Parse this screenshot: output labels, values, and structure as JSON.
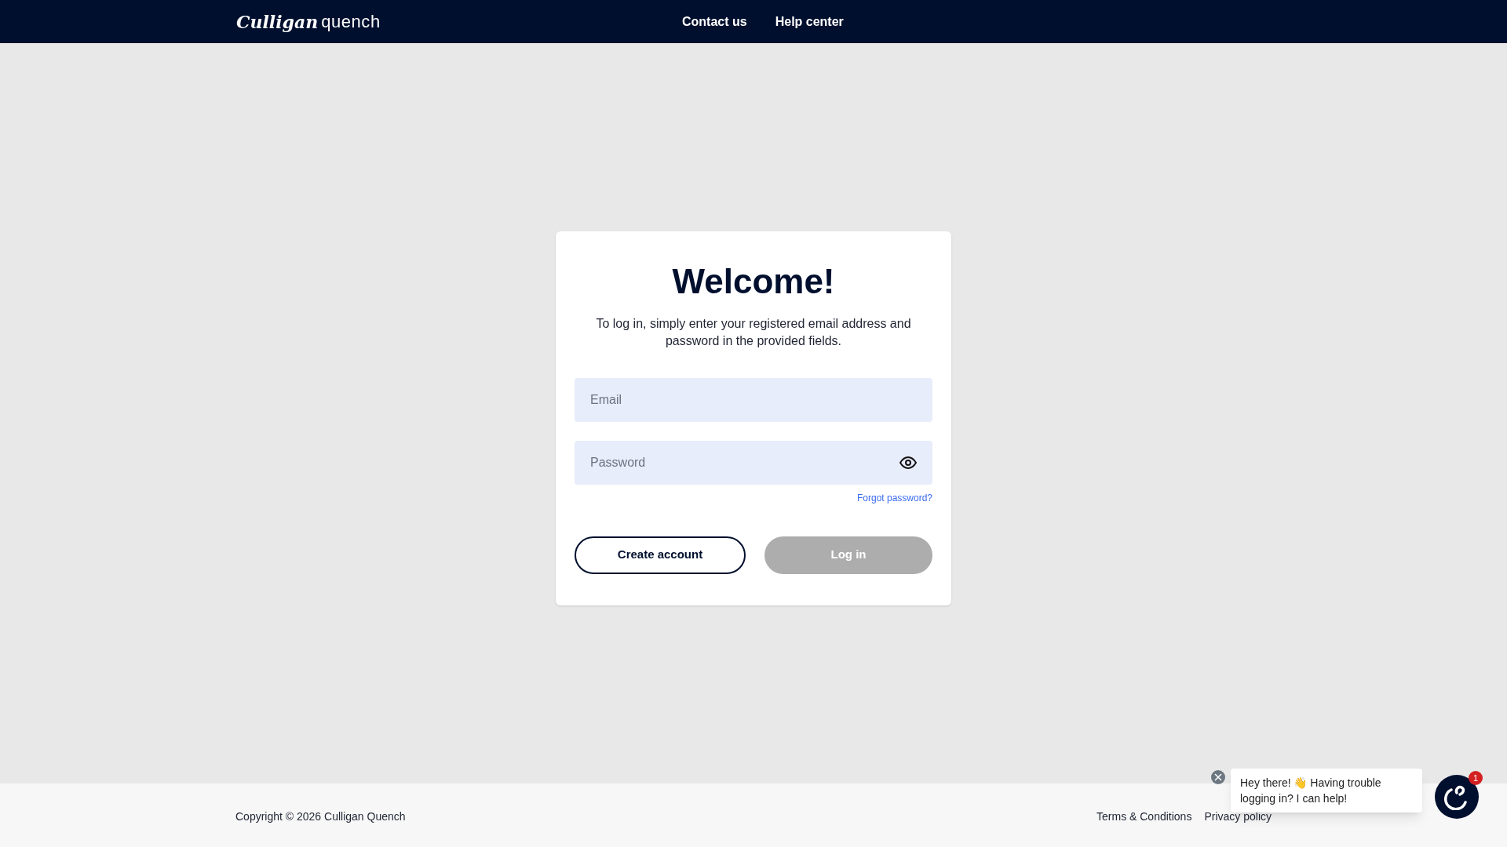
{
  "header": {
    "logo": {
      "brand": "Culligan",
      "product": "quench"
    },
    "nav": [
      "Contact us",
      "Help center"
    ]
  },
  "login_card": {
    "title": "Welcome!",
    "description": "To log in, simply enter your registered email address and password in the provided fields.",
    "email": {
      "placeholder": "Email"
    },
    "password": {
      "placeholder": "Password"
    },
    "forgot_link": "Forgot password?",
    "buttons": [
      {
        "label": "Create account",
        "kind": "outline",
        "disabled": false
      },
      {
        "label": "Log in",
        "kind": "primary",
        "disabled": true
      }
    ]
  },
  "footer": {
    "copyright": "Copyright © 2026 Culligan Quench",
    "links": [
      "Terms & Conditions",
      "Privacy policy"
    ]
  },
  "chat": {
    "message": "Hey there! 👋 Having trouble logging in? I can help!",
    "badge": "1"
  }
}
